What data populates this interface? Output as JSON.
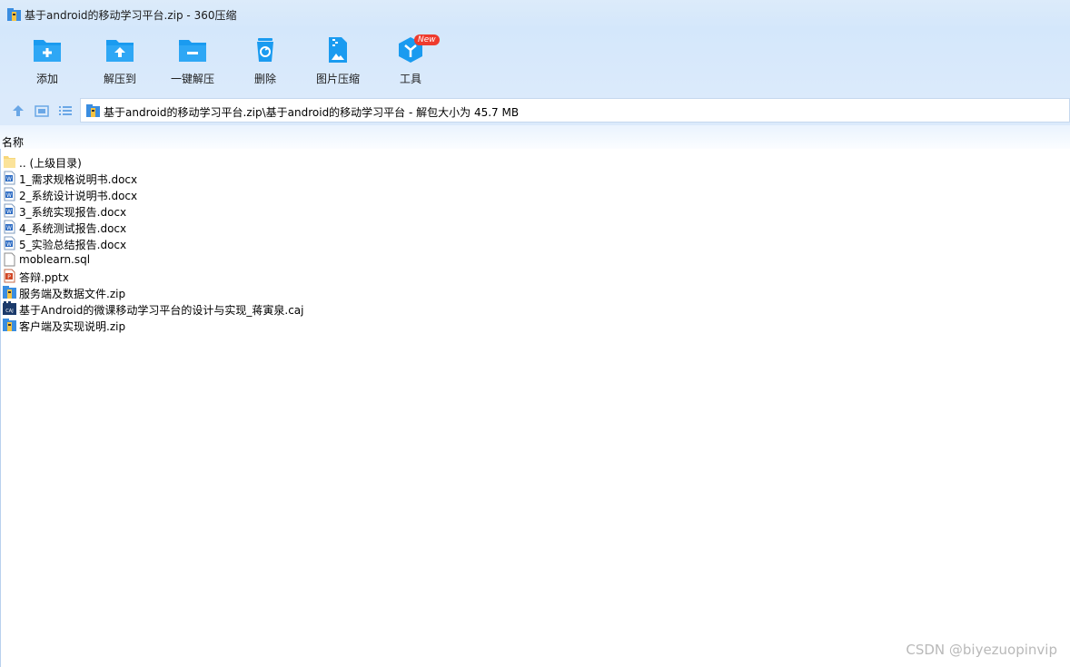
{
  "window": {
    "title": "基于android的移动学习平台.zip - 360压缩"
  },
  "toolbar": {
    "buttons": [
      {
        "label": "添加",
        "icon": "add-folder-icon"
      },
      {
        "label": "解压到",
        "icon": "extract-to-icon"
      },
      {
        "label": "一键解压",
        "icon": "one-click-extract-icon"
      },
      {
        "label": "删除",
        "icon": "delete-icon"
      },
      {
        "label": "图片压缩",
        "icon": "image-compress-icon"
      },
      {
        "label": "工具",
        "icon": "tools-icon",
        "badge": "New"
      }
    ]
  },
  "address": {
    "path": "基于android的移动学习平台.zip\\基于android的移动学习平台 - 解包大小为 45.7 MB"
  },
  "list": {
    "column_name": "名称",
    "files": [
      {
        "name": ".. (上级目录)",
        "type": "folder"
      },
      {
        "name": "1_需求规格说明书.docx",
        "type": "docx"
      },
      {
        "name": "2_系统设计说明书.docx",
        "type": "docx"
      },
      {
        "name": "3_系统实现报告.docx",
        "type": "docx"
      },
      {
        "name": "4_系统测试报告.docx",
        "type": "docx"
      },
      {
        "name": "5_实验总结报告.docx",
        "type": "docx"
      },
      {
        "name": "moblearn.sql",
        "type": "sql"
      },
      {
        "name": "答辩.pptx",
        "type": "pptx"
      },
      {
        "name": "服务端及数据文件.zip",
        "type": "zip"
      },
      {
        "name": "基于Android的微课移动学习平台的设计与实现_蒋寅泉.caj",
        "type": "caj"
      },
      {
        "name": "客户端及实现说明.zip",
        "type": "zip"
      }
    ]
  },
  "watermark": "CSDN @biyezuopinvip",
  "colors": {
    "accent": "#1a9bf0",
    "toolbar_bg": "#d4e7fb",
    "badge": "#ef3b2d"
  }
}
